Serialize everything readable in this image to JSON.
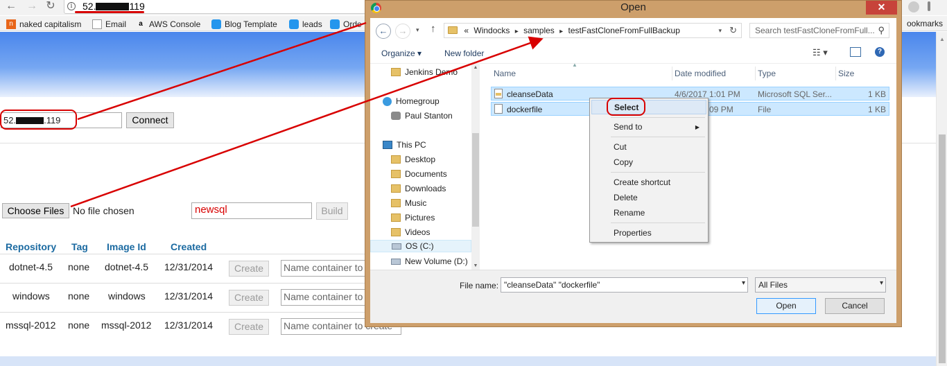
{
  "browser": {
    "url_prefix": "52.",
    "url_suffix": "119",
    "back_glyph": "←",
    "forward_glyph": "→",
    "reload_glyph": "↻",
    "bookmarks": [
      {
        "label": "naked capitalism",
        "icon": "n-logo-icon"
      },
      {
        "label": "Email",
        "icon": "page-icon"
      },
      {
        "label": "AWS Console",
        "icon": "amazon-icon"
      },
      {
        "label": "Blog Template",
        "icon": "docker-icon"
      },
      {
        "label": "leads",
        "icon": "docker-icon"
      },
      {
        "label": "Orde",
        "icon": "docker-icon"
      }
    ],
    "bookmarks_right": "ookmarks"
  },
  "page": {
    "ip_prefix": "52.",
    "ip_suffix": ".119",
    "connect_label": "Connect",
    "choose_files_label": "Choose Files",
    "no_file_label": "No file chosen",
    "build_name_value": "newsql",
    "build_label": "Build",
    "columns": [
      "Repository",
      "Tag",
      "Image Id",
      "Created"
    ],
    "rows": [
      {
        "repository": "dotnet-4.5",
        "tag": "none",
        "image_id": "dotnet-4.5",
        "created": "12/31/2014",
        "create_label": "Create",
        "name_placeholder": "Name container to create"
      },
      {
        "repository": "windows",
        "tag": "none",
        "image_id": "windows",
        "created": "12/31/2014",
        "create_label": "Create",
        "name_placeholder": "Name container to create"
      },
      {
        "repository": "mssql-2012",
        "tag": "none",
        "image_id": "mssql-2012",
        "created": "12/31/2014",
        "create_label": "Create",
        "name_placeholder": "Name container to create"
      }
    ]
  },
  "dialog": {
    "title": "Open",
    "close_glyph": "✕",
    "breadcrumb": [
      "Windocks",
      "samples",
      "testFastCloneFromFullBackup"
    ],
    "breadcrumb_prefix": "«",
    "search_placeholder": "Search testFastCloneFromFull...",
    "organize_label": "Organize ▾",
    "new_folder_label": "New folder",
    "nav_items": [
      {
        "label": "Jenkins Demo",
        "icon": "folder-icon"
      },
      {
        "label": "Homegroup",
        "icon": "homegroup-icon"
      },
      {
        "label": "Paul Stanton",
        "icon": "user-icon"
      },
      {
        "label": "This PC",
        "icon": "computer-icon"
      },
      {
        "label": "Desktop",
        "icon": "folder-icon"
      },
      {
        "label": "Documents",
        "icon": "folder-icon"
      },
      {
        "label": "Downloads",
        "icon": "folder-icon"
      },
      {
        "label": "Music",
        "icon": "folder-icon"
      },
      {
        "label": "Pictures",
        "icon": "folder-icon"
      },
      {
        "label": "Videos",
        "icon": "folder-icon"
      },
      {
        "label": "OS (C:)",
        "icon": "drive-icon"
      },
      {
        "label": "New Volume (D:)",
        "icon": "drive-icon"
      }
    ],
    "columns": [
      "Name",
      "Date modified",
      "Type",
      "Size"
    ],
    "files": [
      {
        "name": "cleanseData",
        "date": "4/6/2017 1:01 PM",
        "type": "Microsoft SQL Ser...",
        "size": "1 KB"
      },
      {
        "name": "dockerfile",
        "date": "3:09 PM",
        "type": "File",
        "size": "1 KB"
      }
    ],
    "filename_label": "File name:",
    "filename_value": "\"cleanseData\" \"dockerfile\"",
    "filetype_value": "All Files",
    "open_label": "Open",
    "cancel_label": "Cancel"
  },
  "context_menu": {
    "items": [
      "Select",
      "Send to",
      "Cut",
      "Copy",
      "Create shortcut",
      "Delete",
      "Rename",
      "Properties"
    ]
  },
  "colors": {
    "annotation_red": "#d80000",
    "header_blue": "#1b6aa1",
    "dialog_frame": "#cd9f6b",
    "selection": "#cce8ff"
  }
}
